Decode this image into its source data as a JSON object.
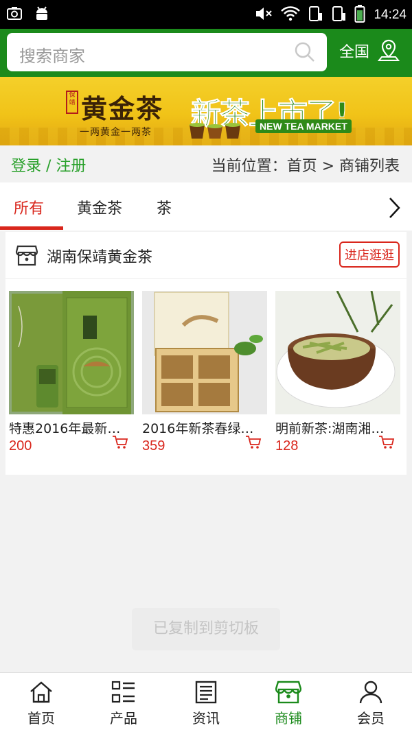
{
  "status_bar": {
    "time": "14:24"
  },
  "header": {
    "search_placeholder": "搜索商家",
    "region_label": "全国"
  },
  "banner": {
    "brand": "黄金茶",
    "seal_text": "保靖",
    "slogan": "一两黄金一两茶",
    "headline": "新茶上市了!",
    "english_tag": "NEW TEA MARKET"
  },
  "breadcrumb_bar": {
    "login_register": "登录 / 注册",
    "location": "当前位置：首页 > 商铺列表"
  },
  "tabs": [
    {
      "label": "所有",
      "active": true
    },
    {
      "label": "黄金茶",
      "active": false
    },
    {
      "label": "茶",
      "active": false
    }
  ],
  "store": {
    "name": "湖南保靖黄金茶",
    "visit_label": "进店逛逛",
    "products": [
      {
        "name": "特惠2016年最新…",
        "price": "200"
      },
      {
        "name": "2016年新茶春绿…",
        "price": "359"
      },
      {
        "name": "明前新茶:湖南湘…",
        "price": "128"
      }
    ]
  },
  "toast": "已复制到剪切板",
  "bottom_nav": [
    {
      "label": "首页",
      "icon": "home-icon",
      "active": false
    },
    {
      "label": "产品",
      "icon": "product-list-icon",
      "active": false
    },
    {
      "label": "资讯",
      "icon": "news-icon",
      "active": false
    },
    {
      "label": "商铺",
      "icon": "shop-icon",
      "active": true
    },
    {
      "label": "会员",
      "icon": "member-icon",
      "active": false
    }
  ],
  "colors": {
    "header_green": "#1b8a1b",
    "accent_red": "#d9261c",
    "link_green": "#28a02a"
  }
}
